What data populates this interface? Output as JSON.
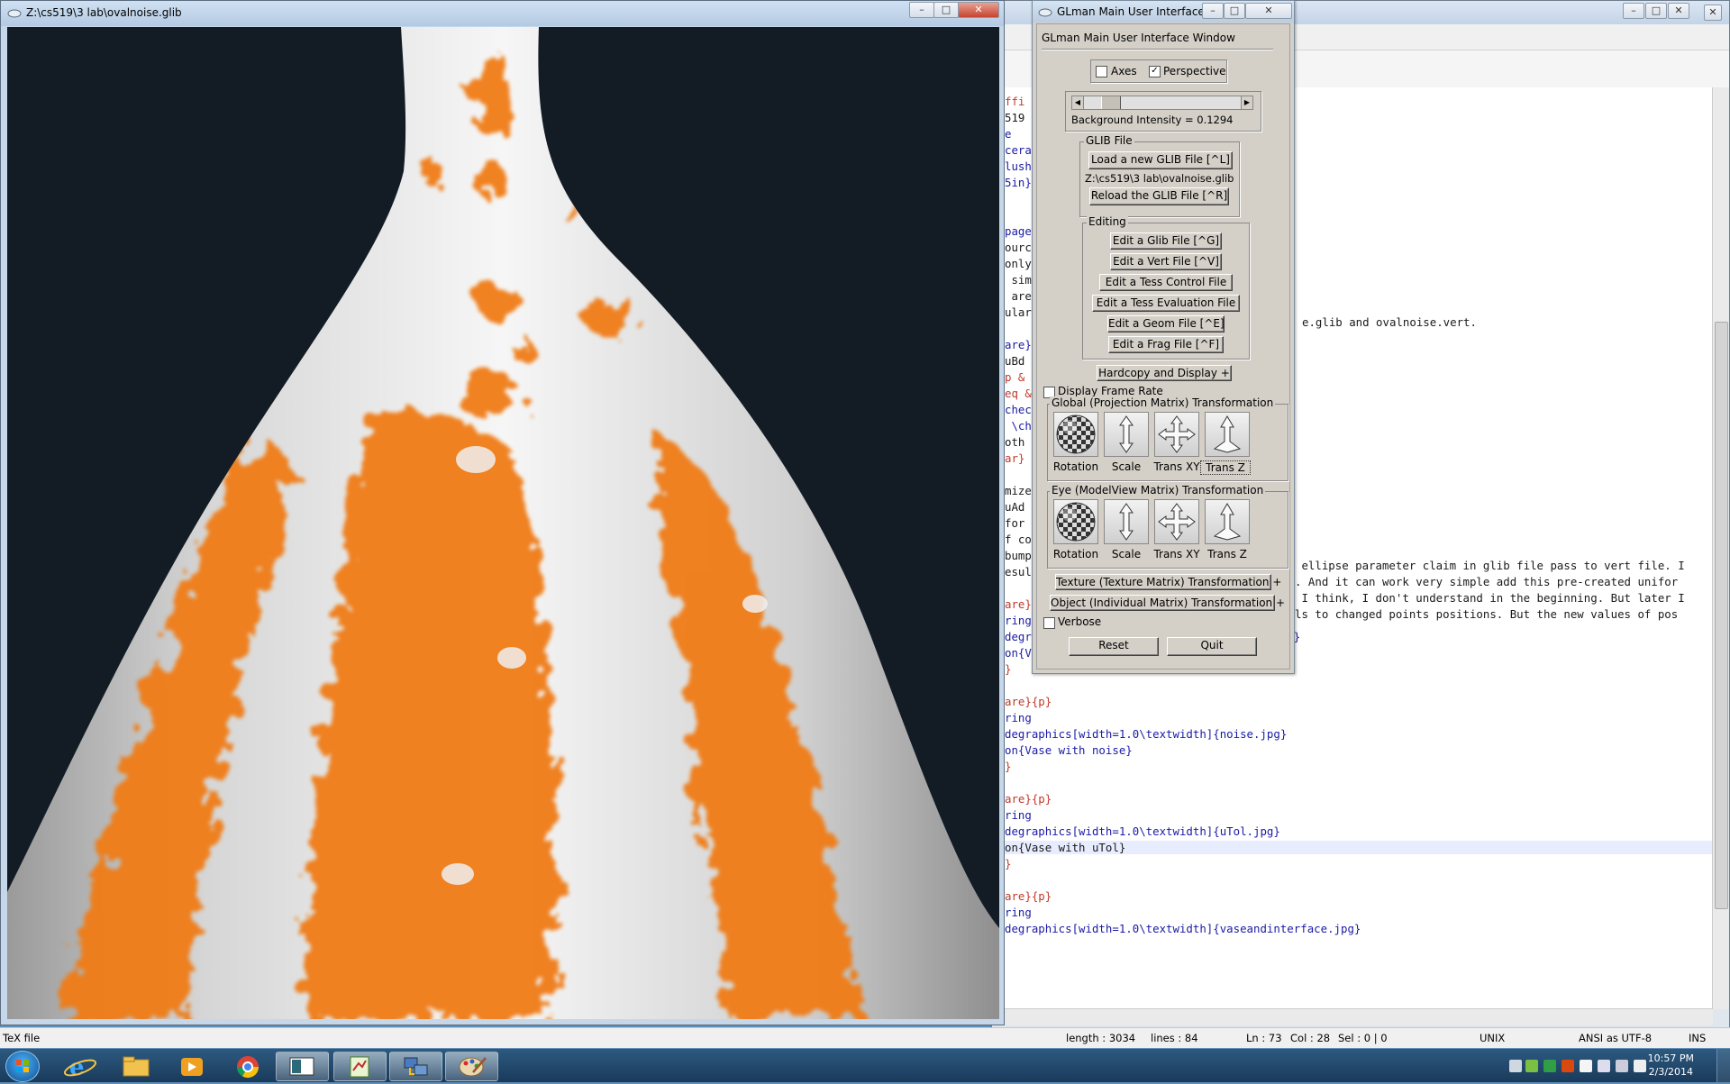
{
  "editor": {
    "code_lines": [
      {
        "t": "ffi",
        "k": "br"
      },
      {
        "t": "519",
        "k": ""
      },
      {
        "t": "e",
        "k": "kw"
      },
      {
        "t": "cera",
        "k": "kw"
      },
      {
        "t": "lush",
        "k": "kw"
      },
      {
        "t": "5in}",
        "k": "kw"
      },
      {
        "t": "",
        "k": ""
      },
      {
        "t": "",
        "k": ""
      },
      {
        "t": "page",
        "k": "kw"
      },
      {
        "t": "ourc",
        "k": ""
      },
      {
        "t": "only",
        "k": ""
      },
      {
        "t": " sim",
        "k": ""
      },
      {
        "t": " are",
        "k": ""
      },
      {
        "t": "ular",
        "k": ""
      },
      {
        "t": "",
        "k": ""
      },
      {
        "t": "are}",
        "k": "kw"
      },
      {
        "t": "uBd ",
        "k": ""
      },
      {
        "t": "p & ",
        "k": "br"
      },
      {
        "t": "eq &",
        "k": "br"
      },
      {
        "t": "chec",
        "k": "kw"
      },
      {
        "t": " \\ch",
        "k": "kw"
      },
      {
        "t": "oth ",
        "k": ""
      },
      {
        "t": "ar}",
        "k": "br"
      },
      {
        "t": "",
        "k": ""
      },
      {
        "t": "mize",
        "k": ""
      },
      {
        "t": "uAd ",
        "k": ""
      },
      {
        "t": "for ",
        "k": ""
      },
      {
        "t": "f co",
        "k": ""
      },
      {
        "t": "bump",
        "k": ""
      },
      {
        "t": "esul",
        "k": ""
      },
      {
        "t": "",
        "k": ""
      },
      {
        "t": "are}{p}",
        "k": "br"
      },
      {
        "t": "ring",
        "k": "kw"
      },
      {
        "t": "degraphics[width=1.0\\textwidth]{ellipse.jpg}",
        "k": "kw"
      },
      {
        "t": "on{Vase with ellipses}",
        "k": "kw"
      },
      {
        "t": "}",
        "k": "br"
      },
      {
        "t": "",
        "k": ""
      },
      {
        "t": "are}{p}",
        "k": "br"
      },
      {
        "t": "ring",
        "k": "kw"
      },
      {
        "t": "degraphics[width=1.0\\textwidth]{noise.jpg}",
        "k": "kw"
      },
      {
        "t": "on{Vase with noise}",
        "k": "kw"
      },
      {
        "t": "}",
        "k": "br"
      },
      {
        "t": "",
        "k": ""
      },
      {
        "t": "are}{p}",
        "k": "br"
      },
      {
        "t": "ring",
        "k": "kw"
      },
      {
        "t": "degraphics[width=1.0\\textwidth]{uTol.jpg}",
        "k": "kw"
      },
      {
        "t": "on{Vase with uTol}",
        "k": "hl"
      },
      {
        "t": "}",
        "k": "br"
      },
      {
        "t": "",
        "k": ""
      },
      {
        "t": "are}{p}",
        "k": "br"
      },
      {
        "t": "ring",
        "k": "kw"
      },
      {
        "t": "degraphics[width=1.0\\textwidth]{vaseandinterface.jpg}",
        "k": "kw"
      }
    ],
    "visible_tail_lines": {
      "glib_line": "e.glib and ovalnoise.vert.",
      "ellipse_line": " ellipse parameter claim in glib file pass to vert file. I",
      "uniform_line": ". And it can work very simple add this pre-created unifor",
      "think_line": " I think, I don't understand in the beginning. But later I",
      "changed_line": "ls to changed points positions. But the new values of pos"
    }
  },
  "statusbar": {
    "file_type": "TeX file",
    "length": "length : 3034",
    "lines": "lines : 84",
    "ln": "Ln : 73",
    "col": "Col : 28",
    "sel": "Sel : 0 | 0",
    "eol": "UNIX",
    "encoding": "ANSI as UTF-8",
    "ins": "INS"
  },
  "render_window": {
    "title": "Z:\\cs519\\3 lab\\ovalnoise.glib",
    "colors": {
      "background": "#131c24",
      "orange": "#f07c12",
      "vase_light": "#f4f4f4",
      "vase_shadow": "#a8a8a8"
    }
  },
  "glman": {
    "title": "GLman Main User Interface ...",
    "panel_title": "GLman Main User Interface Window",
    "axes_label": "Axes",
    "axes_checked": false,
    "perspective_label": "Perspective",
    "perspective_checked": true,
    "background_intensity_label": "Background Intensity = 0.1294",
    "background_intensity": 0.1294,
    "glib_group": "GLIB File",
    "load_button": "Load a new GLIB File [^L]",
    "current_file": "Z:\\cs519\\3 lab\\ovalnoise.glib",
    "reload_button": "Reload the GLIB File [^R]",
    "editing_group": "Editing",
    "edit_buttons": [
      "Edit a Glib File [^G]",
      "Edit a Vert File [^V]",
      "Edit a Tess Control File",
      "Edit a Tess Evaluation File",
      "Edit a Geom File [^E]",
      "Edit a Frag File [^F]"
    ],
    "hardcopy_button": "Hardcopy and Display",
    "display_frame_rate": "Display Frame Rate",
    "display_frame_rate_checked": false,
    "global_group": "Global (Projection Matrix) Transformation",
    "eye_group": "Eye (ModelView Matrix) Transformation",
    "transform_labels": [
      "Rotation",
      "Scale",
      "Trans XY",
      "Trans Z"
    ],
    "texture_button": "Texture (Texture Matrix) Transformation",
    "object_button": "Object (Individual Matrix) Transformation",
    "verbose": "Verbose",
    "verbose_checked": false,
    "reset_button": "Reset",
    "quit_button": "Quit"
  },
  "taskbar": {
    "time": "10:57 PM",
    "date": "2/3/2014",
    "apps": [
      "start-button",
      "internet-explorer",
      "file-explorer",
      "media-player",
      "chrome",
      "glman",
      "notepad-plus",
      "network-tool",
      "paint"
    ]
  }
}
